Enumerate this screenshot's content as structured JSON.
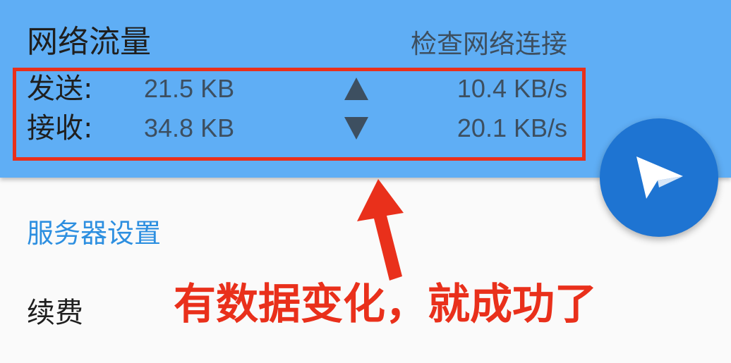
{
  "network_card": {
    "title": "网络流量",
    "check_connection_label": "检查网络连接",
    "send": {
      "label": "发送:",
      "total": "21.5 KB",
      "speed": "10.4 KB/s",
      "arrow_icon": "triangle-up-icon"
    },
    "receive": {
      "label": "接收:",
      "total": "34.8 KB",
      "speed": "20.1 KB/s",
      "arrow_icon": "triangle-down-icon"
    }
  },
  "fab": {
    "icon": "paper-plane-icon",
    "color": "#1e74d2"
  },
  "settings": {
    "section_header": "服务器设置",
    "items": [
      {
        "label": "续费"
      }
    ]
  },
  "annotation": {
    "text": "有数据变化，就成功了",
    "color": "#e9301b"
  },
  "colors": {
    "header_bg": "#5faef5",
    "accent_blue": "#2d8fe0",
    "stat_text": "#3d4f60"
  }
}
